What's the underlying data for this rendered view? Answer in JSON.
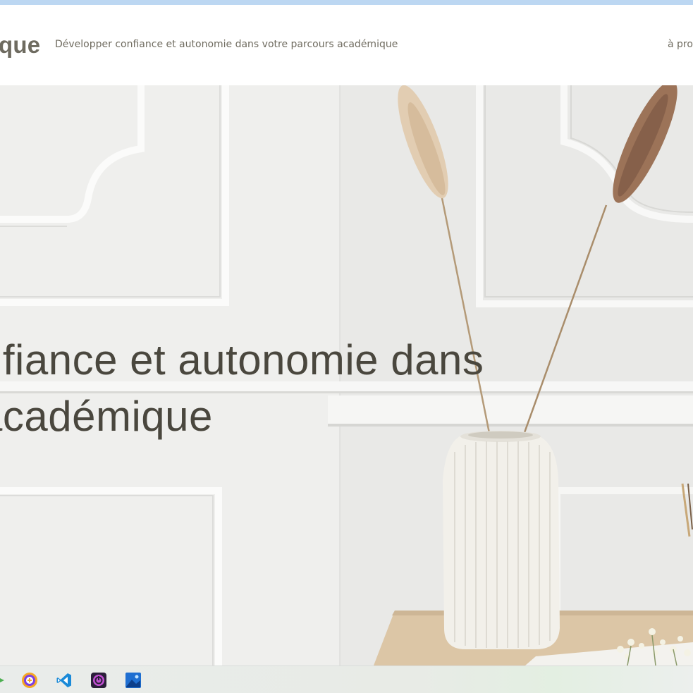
{
  "header": {
    "site_title": "que",
    "tagline": "Développer confiance et autonomie dans votre parcours académique",
    "nav": [
      {
        "label": "à pro"
      }
    ]
  },
  "hero": {
    "heading_line1": "nfiance et autonomie dans",
    "heading_line2": "académique"
  },
  "taskbar": {
    "icons": [
      "arrow-icon",
      "browser-icon",
      "vscode-icon",
      "power-app-icon",
      "photos-icon"
    ]
  },
  "colors": {
    "top_strip": "#bcd7f2",
    "text": "#4a473e",
    "header_text": "#6f6b5f",
    "wall": "#eeeeec"
  }
}
